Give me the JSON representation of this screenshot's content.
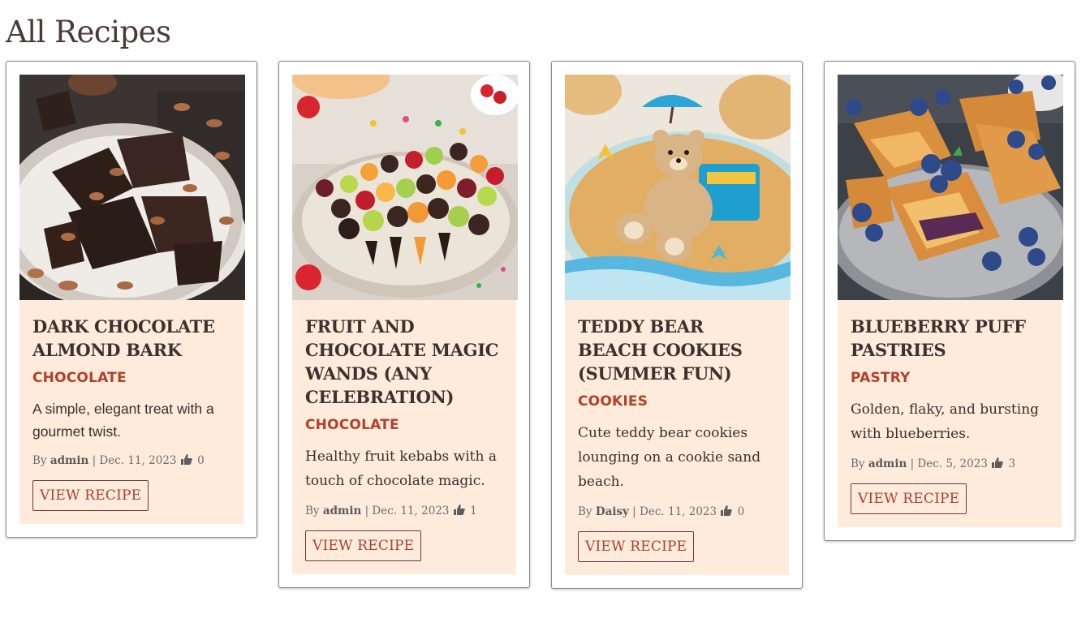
{
  "page": {
    "title": "All Recipes"
  },
  "cards": [
    {
      "title": "Dark Chocolate Almond Bark",
      "category": "Chocolate",
      "description": "A simple, elegant treat with a gourmet twist.",
      "by_label": "By",
      "author": "admin",
      "date": "Dec. 11, 2023",
      "likes": "0",
      "button": "View Recipe",
      "image": "dark-chocolate-almond-bark-photo"
    },
    {
      "title": "Fruit and Chocolate Magic Wands (Any Celebration)",
      "category": "Chocolate",
      "description": "Healthy fruit kebabs with a touch of chocolate magic.",
      "by_label": "By",
      "author": "admin",
      "date": "Dec. 11, 2023",
      "likes": "1",
      "button": "View Recipe",
      "image": "fruit-chocolate-wands-photo"
    },
    {
      "title": "Teddy Bear Beach Cookies (Summer Fun)",
      "category": "Cookies",
      "description": "Cute teddy bear cookies lounging on a cookie sand beach.",
      "by_label": "By",
      "author": "Daisy",
      "date": "Dec. 11, 2023",
      "likes": "0",
      "button": "View Recipe",
      "image": "teddy-bear-beach-cookies-photo"
    },
    {
      "title": "Blueberry Puff Pastries",
      "category": "Pastry",
      "description": "Golden, flaky, and bursting with blueberries.",
      "by_label": "By",
      "author": "admin",
      "date": "Dec. 5, 2023",
      "likes": "3",
      "button": "View Recipe",
      "image": "blueberry-puff-pastries-photo"
    }
  ],
  "icons": {
    "like": "thumbs-up-icon"
  },
  "colors": {
    "card_background": "#feebdc",
    "category": "#b2402a",
    "button_text": "#a8412f",
    "title_text": "#3d3130"
  }
}
